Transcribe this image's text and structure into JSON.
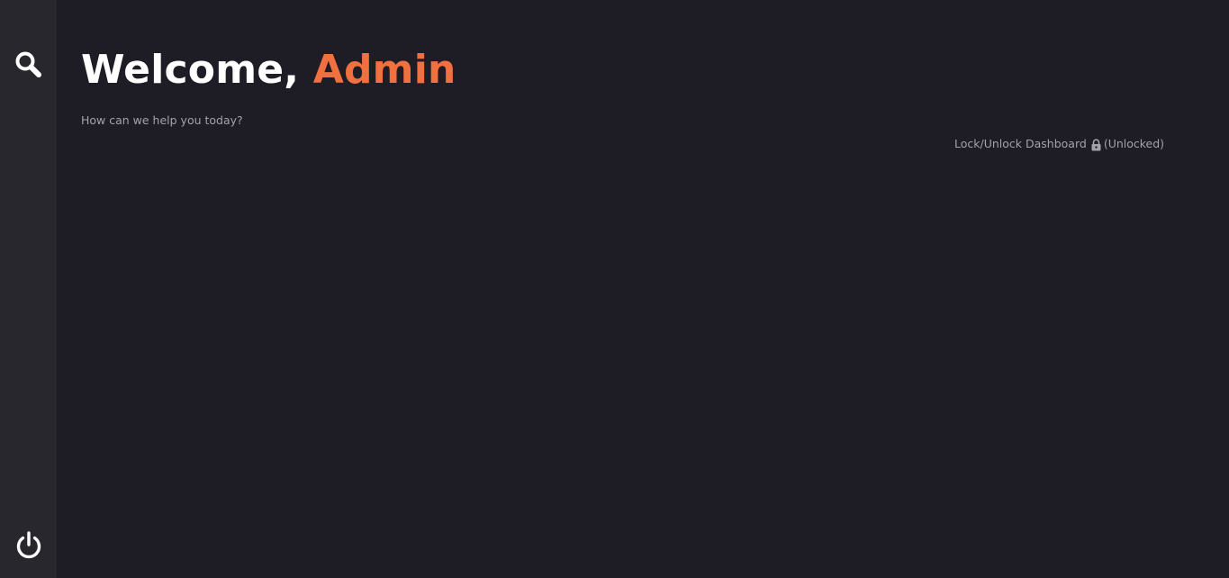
{
  "header": {
    "greeting": "Welcome, ",
    "user_name": "Admin",
    "subtitle": "How can we help you today?"
  },
  "dashboard": {
    "lock_label": "Lock/Unlock Dashboard",
    "lock_state": "(Unlocked)",
    "lock_icon": "padlock-icon"
  },
  "sidebar": {
    "top_icon": "search-icon",
    "bottom_icon": "power-icon"
  },
  "colors": {
    "background": "#1e1d26",
    "sidebar": "#28272d",
    "accent": "#f0703f",
    "text_primary": "#ffffff",
    "text_muted": "#a3a2a8"
  }
}
